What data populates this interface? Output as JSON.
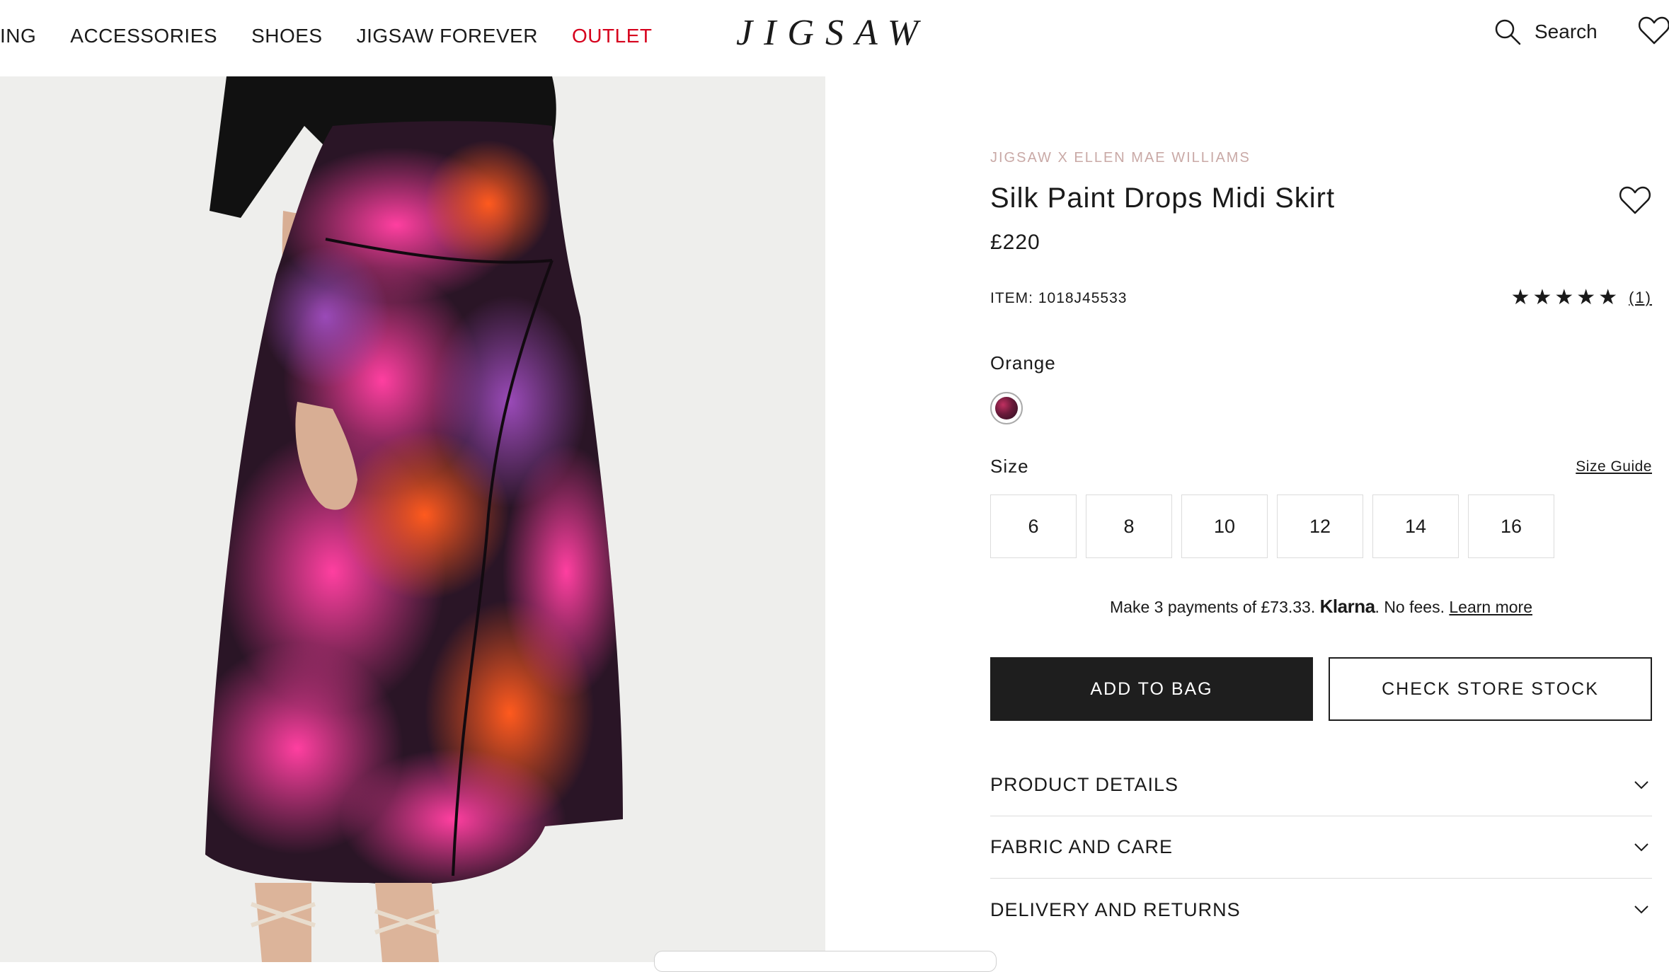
{
  "nav": {
    "items": [
      "ING",
      "ACCESSORIES",
      "SHOES",
      "JIGSAW FOREVER",
      "OUTLET"
    ],
    "logo": "JIGSAW",
    "search_label": "Search"
  },
  "product": {
    "collab": "JIGSAW X ELLEN MAE WILLIAMS",
    "title": "Silk Paint Drops Midi Skirt",
    "price": "£220",
    "item": "ITEM: 1018J45533",
    "rating_stars": 5,
    "review_count": "(1)",
    "colour_label": "Orange",
    "size_label": "Size",
    "size_guide": "Size Guide",
    "sizes": [
      "6",
      "8",
      "10",
      "12",
      "14",
      "16"
    ],
    "klarna": {
      "prefix": "Make 3 payments of £73.33.",
      "brand": "Klarna",
      "middle": ". No fees.",
      "link": "Learn more"
    },
    "add_to_bag": "ADD TO BAG",
    "check_stock": "CHECK STORE STOCK",
    "accordion": [
      "PRODUCT DETAILS",
      "FABRIC AND CARE",
      "DELIVERY AND RETURNS"
    ]
  },
  "colors": {
    "outlet": "#d6001c",
    "collab": "#c9a9a6",
    "button_dark": "#1e1e1e",
    "photo_bg": "#eeeeec"
  },
  "icons": {
    "search": "search-icon",
    "wishlist": "heart-icon",
    "star": "star-icon",
    "chevron": "chevron-down-icon"
  }
}
